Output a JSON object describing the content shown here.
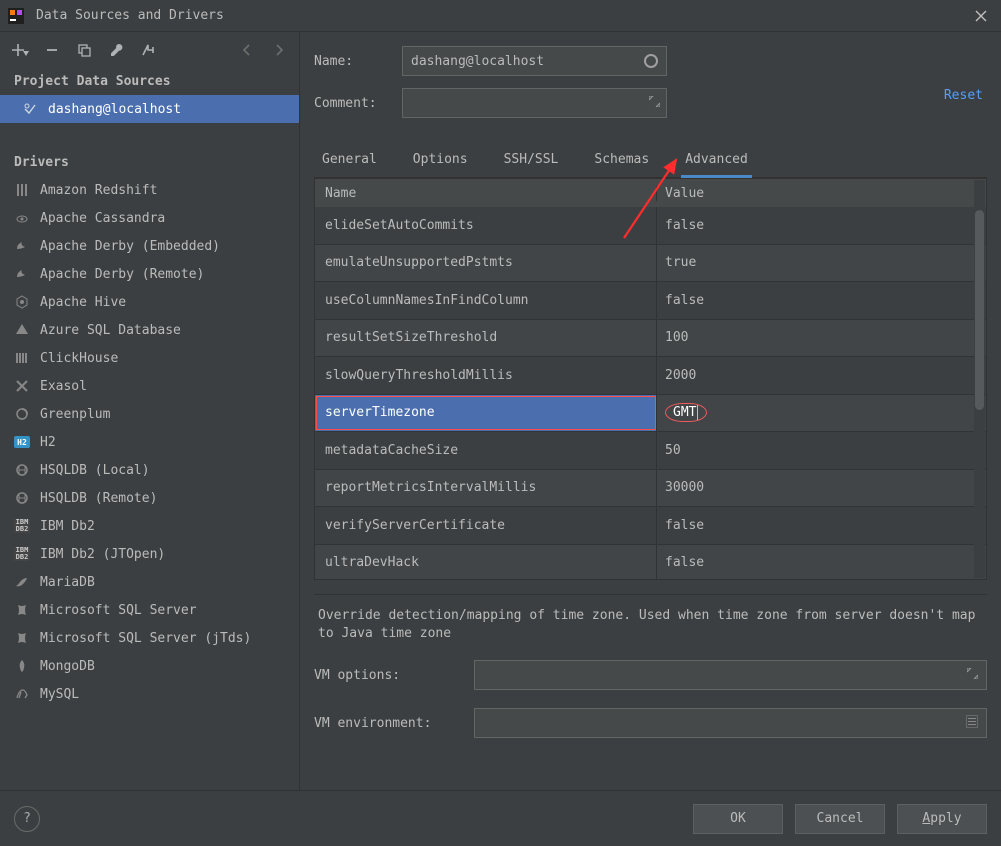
{
  "window": {
    "title": "Data Sources and Drivers"
  },
  "sidebar": {
    "project_header": "Project Data Sources",
    "datasource": "dashang@localhost",
    "drivers_header": "Drivers",
    "drivers": [
      "Amazon Redshift",
      "Apache Cassandra",
      "Apache Derby (Embedded)",
      "Apache Derby (Remote)",
      "Apache Hive",
      "Azure SQL Database",
      "ClickHouse",
      "Exasol",
      "Greenplum",
      "H2",
      "HSQLDB (Local)",
      "HSQLDB (Remote)",
      "IBM Db2",
      "IBM Db2 (JTOpen)",
      "MariaDB",
      "Microsoft SQL Server",
      "Microsoft SQL Server (jTds)",
      "MongoDB",
      "MySQL"
    ]
  },
  "form": {
    "name_label": "Name:",
    "name_value": "dashang@localhost",
    "comment_label": "Comment:",
    "comment_value": "",
    "reset_label": "Reset"
  },
  "tabs": [
    "General",
    "Options",
    "SSH/SSL",
    "Schemas",
    "Advanced"
  ],
  "active_tab": "Advanced",
  "table": {
    "headers": {
      "name": "Name",
      "value": "Value"
    },
    "rows": [
      {
        "name": "elideSetAutoCommits",
        "value": "false"
      },
      {
        "name": "emulateUnsupportedPstmts",
        "value": "true"
      },
      {
        "name": "useColumnNamesInFindColumn",
        "value": "false"
      },
      {
        "name": "resultSetSizeThreshold",
        "value": "100"
      },
      {
        "name": "slowQueryThresholdMillis",
        "value": "2000"
      },
      {
        "name": "serverTimezone",
        "value": "GMT",
        "selected": true,
        "circled": true
      },
      {
        "name": "metadataCacheSize",
        "value": "50"
      },
      {
        "name": "reportMetricsIntervalMillis",
        "value": "30000"
      },
      {
        "name": "verifyServerCertificate",
        "value": "false"
      },
      {
        "name": "ultraDevHack",
        "value": "false"
      }
    ]
  },
  "description": "Override detection/mapping of time zone. Used when time zone from server doesn't map to Java time zone",
  "vm": {
    "options_label": "VM options:",
    "env_label": "VM environment:"
  },
  "footer": {
    "ok": "OK",
    "cancel": "Cancel",
    "apply": "Apply"
  }
}
